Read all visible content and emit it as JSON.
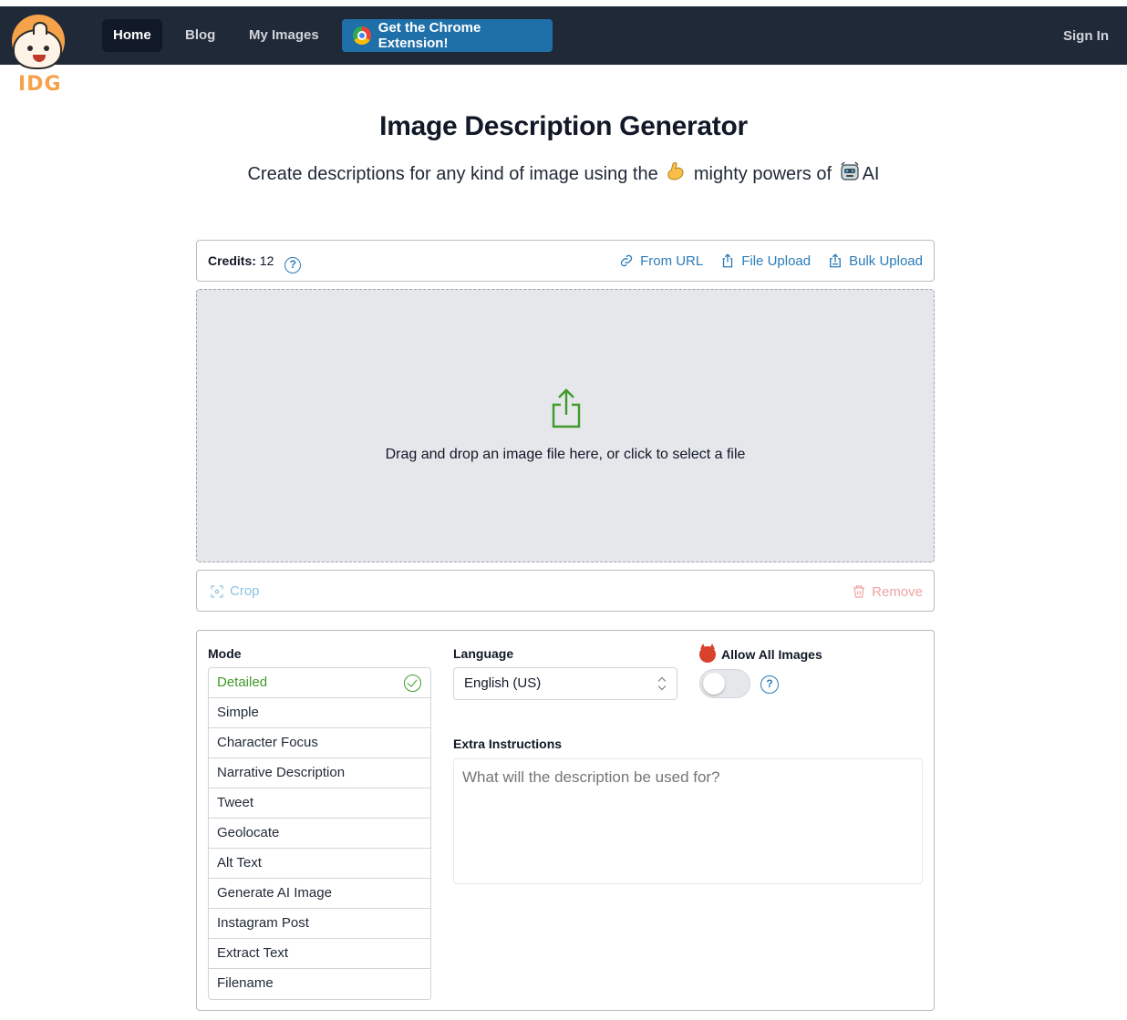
{
  "nav": {
    "logo_text": "IDG",
    "home": "Home",
    "blog": "Blog",
    "my_images": "My Images",
    "chrome_extension": "Get the Chrome Extension!",
    "sign_in": "Sign In"
  },
  "hero": {
    "title": "Image Description Generator",
    "subtitle_part1": "Create descriptions for any kind of image using the",
    "subtitle_part2": "mighty powers of",
    "subtitle_part3": "AI"
  },
  "credits": {
    "label": "Credits:",
    "value": "12"
  },
  "upload": {
    "from_url": "From URL",
    "file_upload": "File Upload",
    "bulk_upload": "Bulk Upload",
    "dropzone_text": "Drag and drop an image file here, or click to select a file"
  },
  "tools": {
    "crop": "Crop",
    "remove": "Remove"
  },
  "options": {
    "mode_label": "Mode",
    "modes": [
      "Detailed",
      "Simple",
      "Character Focus",
      "Narrative Description",
      "Tweet",
      "Geolocate",
      "Alt Text",
      "Generate AI Image",
      "Instagram Post",
      "Extract Text",
      "Filename"
    ],
    "selected_mode": "Detailed",
    "language_label": "Language",
    "language_value": "English (US)",
    "allow_all_label": "Allow All Images",
    "allow_all_enabled": false,
    "extra_label": "Extra Instructions",
    "extra_placeholder": "What will the description be used for?"
  },
  "colors": {
    "navbar": "#1f2937",
    "accent_blue": "#2b7cb9",
    "selected_green": "#3f9a2a",
    "logo_orange": "#f6a24a"
  }
}
